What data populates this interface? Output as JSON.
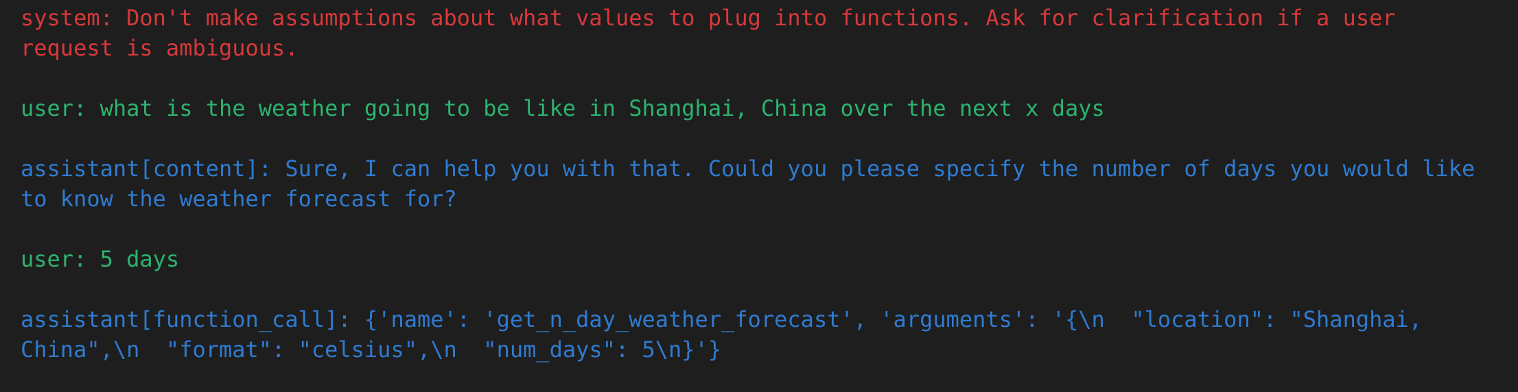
{
  "colors": {
    "background": "#1e1e1e",
    "system": "#d9383a",
    "user": "#2db36f",
    "assistant": "#2f7bd0"
  },
  "messages": [
    {
      "role": "system",
      "text": "system: Don't make assumptions about what values to plug into functions. Ask for clarification if a user request is ambiguous."
    },
    {
      "role": "user",
      "text": "user: what is the weather going to be like in Shanghai, China over the next x days"
    },
    {
      "role": "assistant",
      "text": "assistant[content]: Sure, I can help you with that. Could you please specify the number of days you would like to know the weather forecast for?"
    },
    {
      "role": "user",
      "text": "user: 5 days"
    },
    {
      "role": "assistant",
      "text": "assistant[function_call]: {'name': 'get_n_day_weather_forecast', 'arguments': '{\\n  \"location\": \"Shanghai, China\",\\n  \"format\": \"celsius\",\\n  \"num_days\": 5\\n}'}"
    }
  ]
}
